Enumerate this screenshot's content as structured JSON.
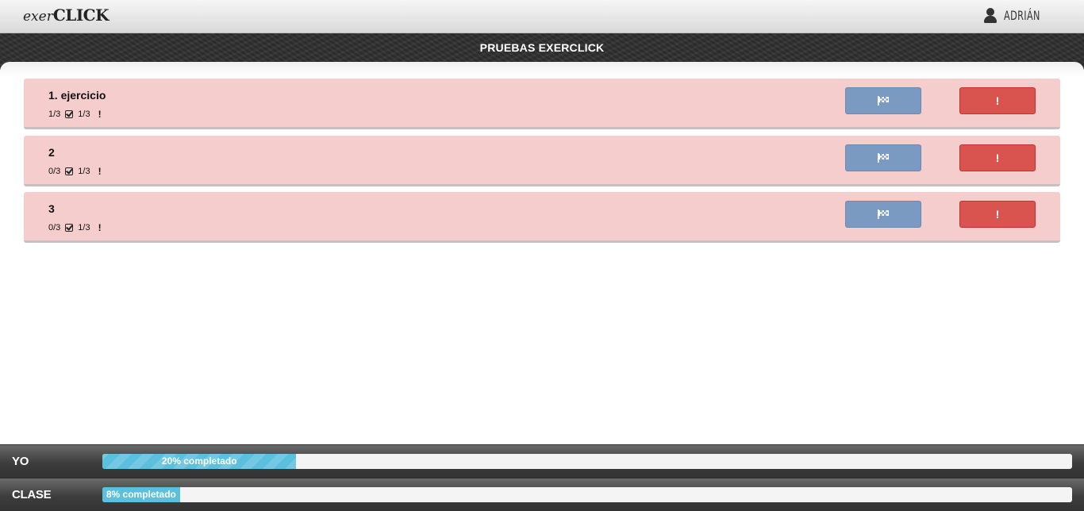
{
  "header": {
    "logo_prefix": "exer",
    "logo_main": "CLICK",
    "user_name": "ADRIÁN",
    "user_icon": "user-icon"
  },
  "board": {
    "title": "PRUEBAS EXERCLICK"
  },
  "exercises": [
    {
      "name": "1. ejercicio",
      "done": "1/3",
      "alerts": "1/3",
      "flag_icon": "flag-icon",
      "alert_icon": "exclamation-icon",
      "alert_button": "!"
    },
    {
      "name": "2",
      "done": "0/3",
      "alerts": "1/3",
      "flag_icon": "flag-icon",
      "alert_icon": "exclamation-icon",
      "alert_button": "!"
    },
    {
      "name": "3",
      "done": "0/3",
      "alerts": "1/3",
      "flag_icon": "flag-icon",
      "alert_icon": "exclamation-icon",
      "alert_button": "!"
    }
  ],
  "progress": {
    "me": {
      "label": "YO",
      "percent": 20,
      "text": "20% completado"
    },
    "class": {
      "label": "CLASE",
      "percent": 8,
      "text": "8% completado"
    }
  },
  "colors": {
    "exercise_bg": "#f5cdcd",
    "flag_button": "#7a9ac2",
    "alert_button": "#d9534f",
    "progress_fill": "#5bc0de"
  }
}
